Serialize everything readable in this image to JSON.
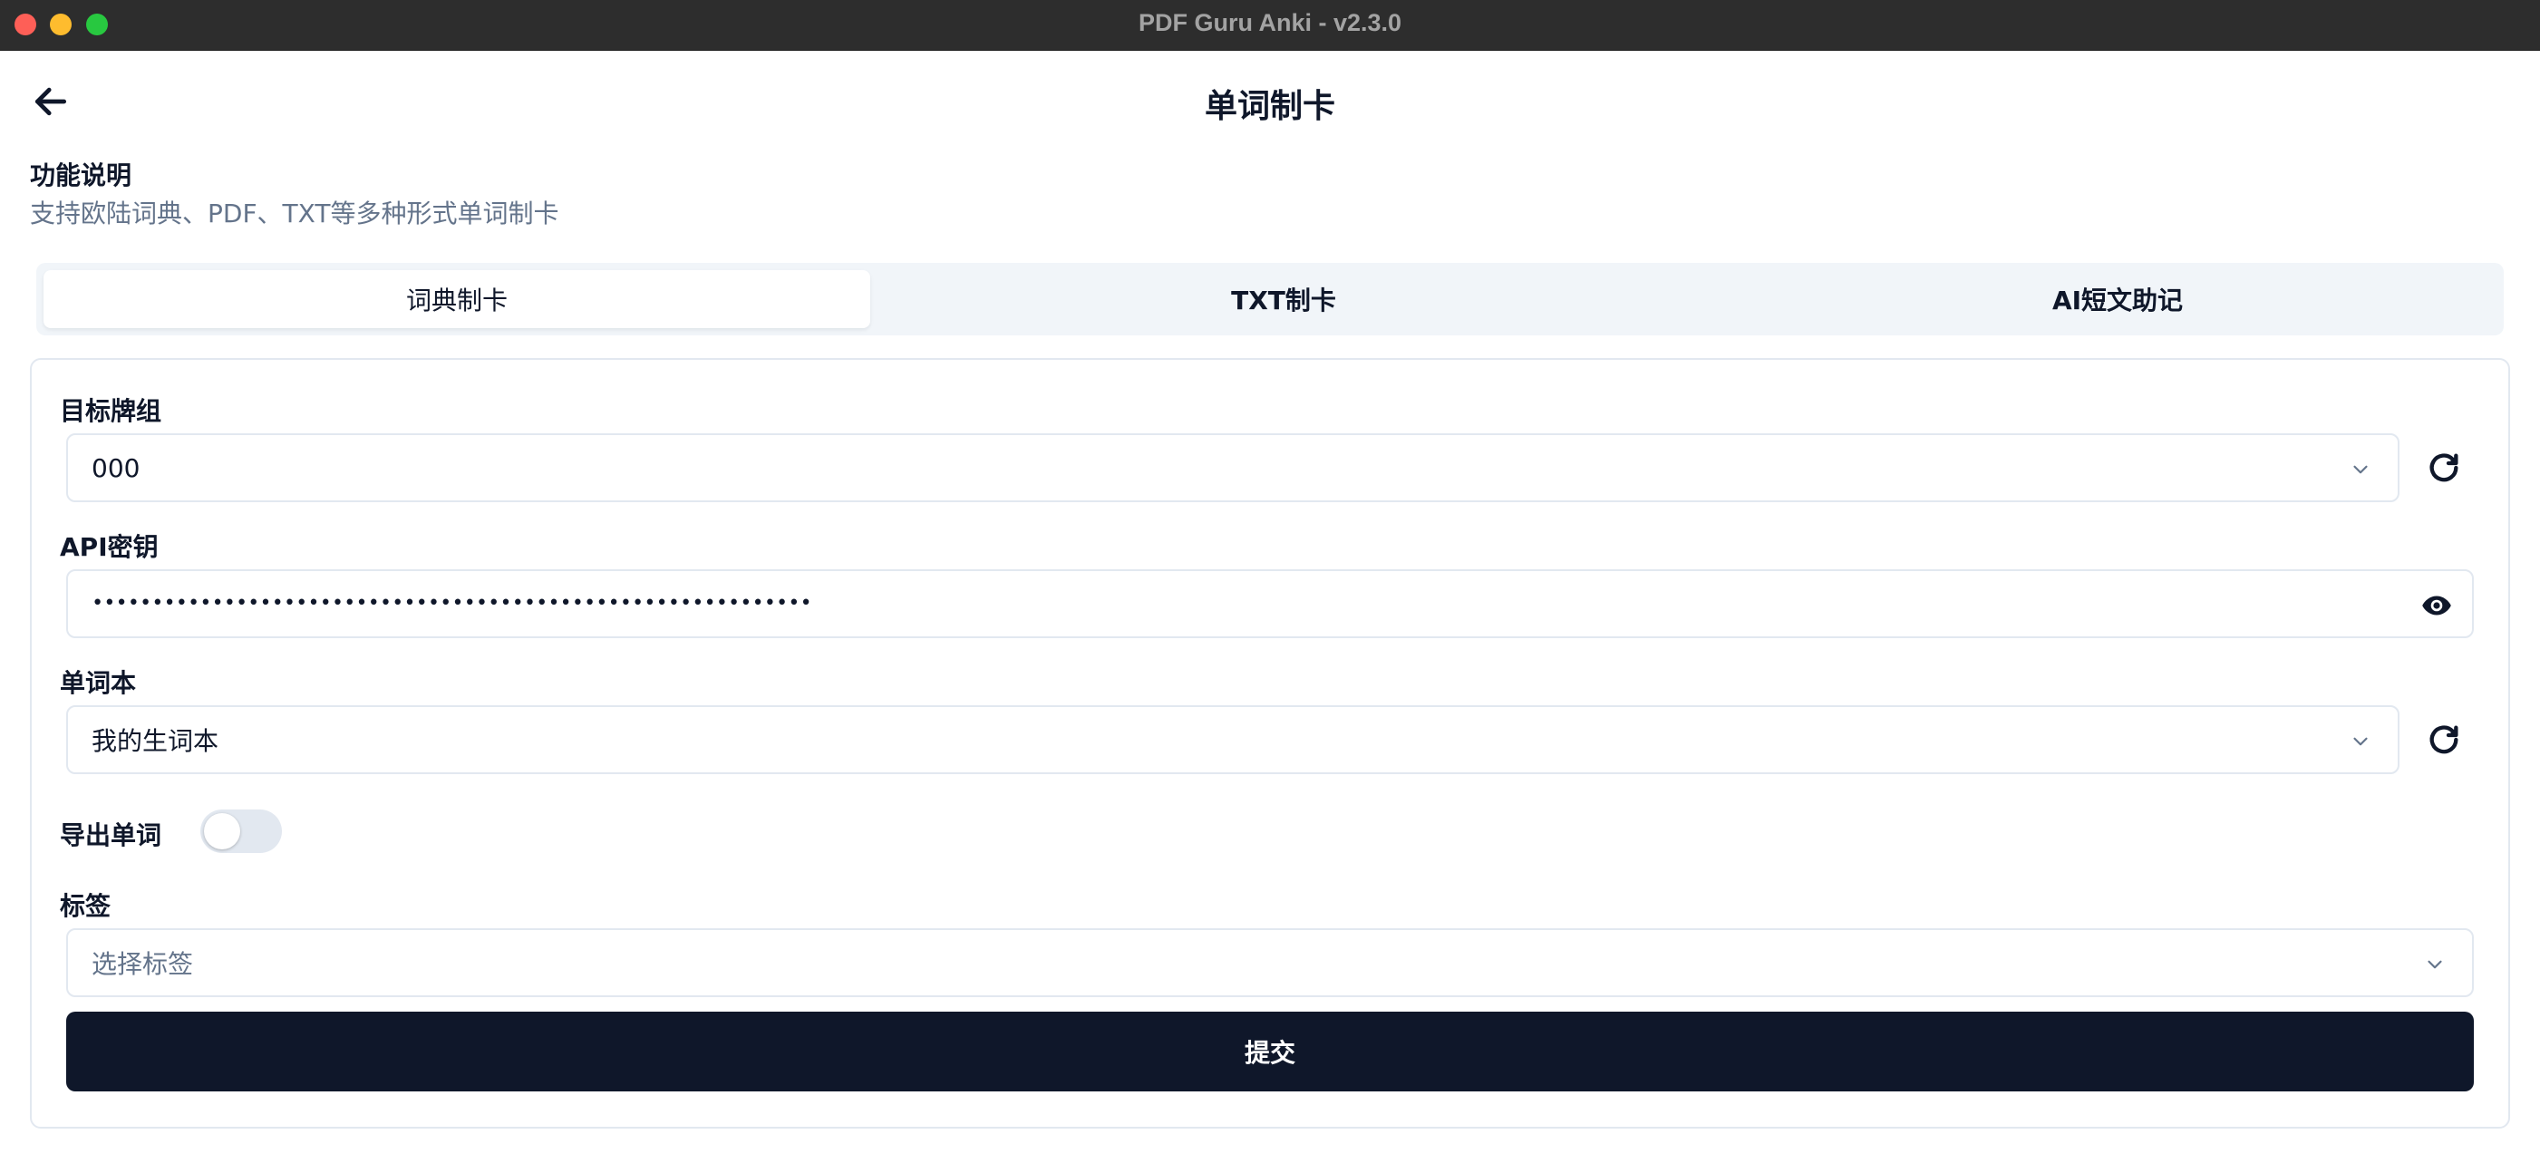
{
  "window": {
    "title": "PDF Guru Anki - v2.3.0"
  },
  "header": {
    "title": "单词制卡"
  },
  "description": {
    "title": "功能说明",
    "text": "支持欧陆词典、PDF、TXT等多种形式单词制卡"
  },
  "tabs": [
    {
      "label": "词典制卡",
      "active": true
    },
    {
      "label": "TXT制卡",
      "active": false
    },
    {
      "label": "AI短文助记",
      "active": false
    }
  ],
  "form": {
    "deck": {
      "label": "目标牌组",
      "value": "000"
    },
    "api_key": {
      "label": "API密钥",
      "masked_value": "••••••••••••••••••••••••••••••••••••••••••••••••••••••••••••"
    },
    "wordbook": {
      "label": "单词本",
      "value": "我的生词本"
    },
    "export_words": {
      "label": "导出单词",
      "enabled": false
    },
    "tags": {
      "label": "标签",
      "placeholder": "选择标签"
    },
    "submit_label": "提交"
  },
  "colors": {
    "accent": "#0f172a",
    "muted_text": "#64748b",
    "border": "#e2e8f0",
    "tab_bg": "#f1f5f9"
  },
  "icons": {
    "back": "arrow-left-icon",
    "chevron": "chevron-down-icon",
    "refresh": "refresh-icon",
    "visibility": "eye-icon"
  }
}
